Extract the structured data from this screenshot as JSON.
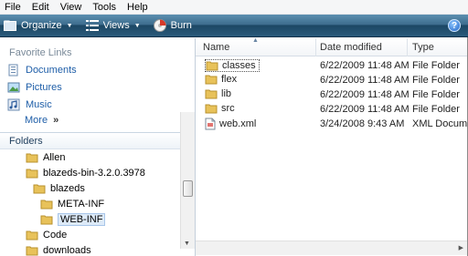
{
  "menu": [
    "File",
    "Edit",
    "View",
    "Tools",
    "Help"
  ],
  "toolbar": {
    "organize_label": "Organize",
    "views_label": "Views",
    "burn_label": "Burn",
    "help_label": "?"
  },
  "favorites": {
    "title": "Favorite Links",
    "items": [
      {
        "label": "Documents",
        "icon": "documents-icon"
      },
      {
        "label": "Pictures",
        "icon": "pictures-icon"
      },
      {
        "label": "Music",
        "icon": "music-icon"
      }
    ],
    "more_label": "More",
    "more_chevron": "»"
  },
  "folders": {
    "title": "Folders",
    "tree": [
      {
        "label": "Allen"
      },
      {
        "label": "blazeds-bin-3.2.0.3978"
      },
      {
        "label": "blazeds"
      },
      {
        "label": "META-INF"
      },
      {
        "label": "WEB-INF",
        "selected": true
      },
      {
        "label": "Code"
      },
      {
        "label": "downloads"
      }
    ]
  },
  "columns": {
    "name": "Name",
    "date": "Date modified",
    "type": "Type"
  },
  "files": [
    {
      "name": "classes",
      "date": "6/22/2009 11:48 AM",
      "type": "File Folder",
      "icon": "folder-icon"
    },
    {
      "name": "flex",
      "date": "6/22/2009 11:48 AM",
      "type": "File Folder",
      "icon": "folder-icon"
    },
    {
      "name": "lib",
      "date": "6/22/2009 11:48 AM",
      "type": "File Folder",
      "icon": "folder-icon"
    },
    {
      "name": "src",
      "date": "6/22/2009 11:48 AM",
      "type": "File Folder",
      "icon": "folder-icon"
    },
    {
      "name": "web.xml",
      "date": "3/24/2008 9:43 AM",
      "type": "XML Docum",
      "icon": "xml-file-icon"
    }
  ],
  "colors": {
    "command_bar": "#2a5a7b",
    "link": "#1e5ea8",
    "folder": "#e8c25a"
  }
}
